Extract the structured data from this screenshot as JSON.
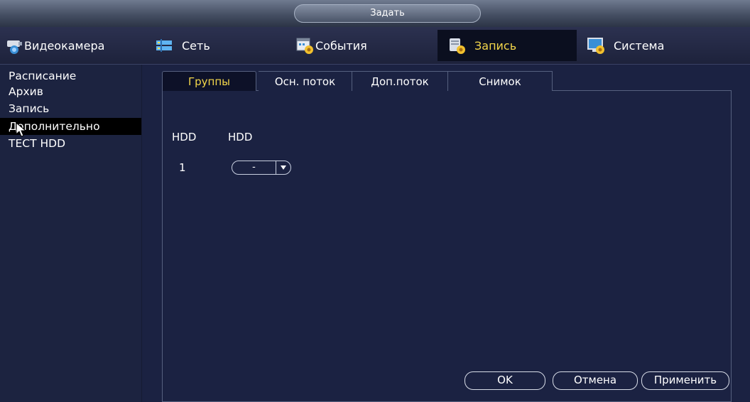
{
  "window": {
    "title": "Задать"
  },
  "topnav": {
    "items": [
      {
        "label": "Видеокамера",
        "icon": "camera-icon"
      },
      {
        "label": "Сеть",
        "icon": "network-icon"
      },
      {
        "label": "События",
        "icon": "events-icon"
      },
      {
        "label": "Запись",
        "icon": "record-icon",
        "active": true
      },
      {
        "label": "Система",
        "icon": "system-icon"
      }
    ]
  },
  "sidebar": {
    "items": [
      {
        "label": "Расписание"
      },
      {
        "label": "Архив"
      },
      {
        "label": "Запись"
      },
      {
        "label": "Дополнительно",
        "active": true
      },
      {
        "label": "ТЕСТ HDD"
      }
    ]
  },
  "tabs": [
    {
      "label": "Группы",
      "active": true
    },
    {
      "label": "Осн. поток"
    },
    {
      "label": "Доп.поток"
    },
    {
      "label": "Снимок"
    }
  ],
  "table": {
    "headers": [
      "HDD",
      "HDD"
    ],
    "rows": [
      {
        "disk": "1",
        "group": "-"
      }
    ]
  },
  "buttons": {
    "ok": "OK",
    "cancel": "Отмена",
    "apply": "Применить"
  },
  "colors": {
    "active_text": "#f3d64a",
    "background": "#1b2242",
    "sidebar": "#1c2340"
  }
}
